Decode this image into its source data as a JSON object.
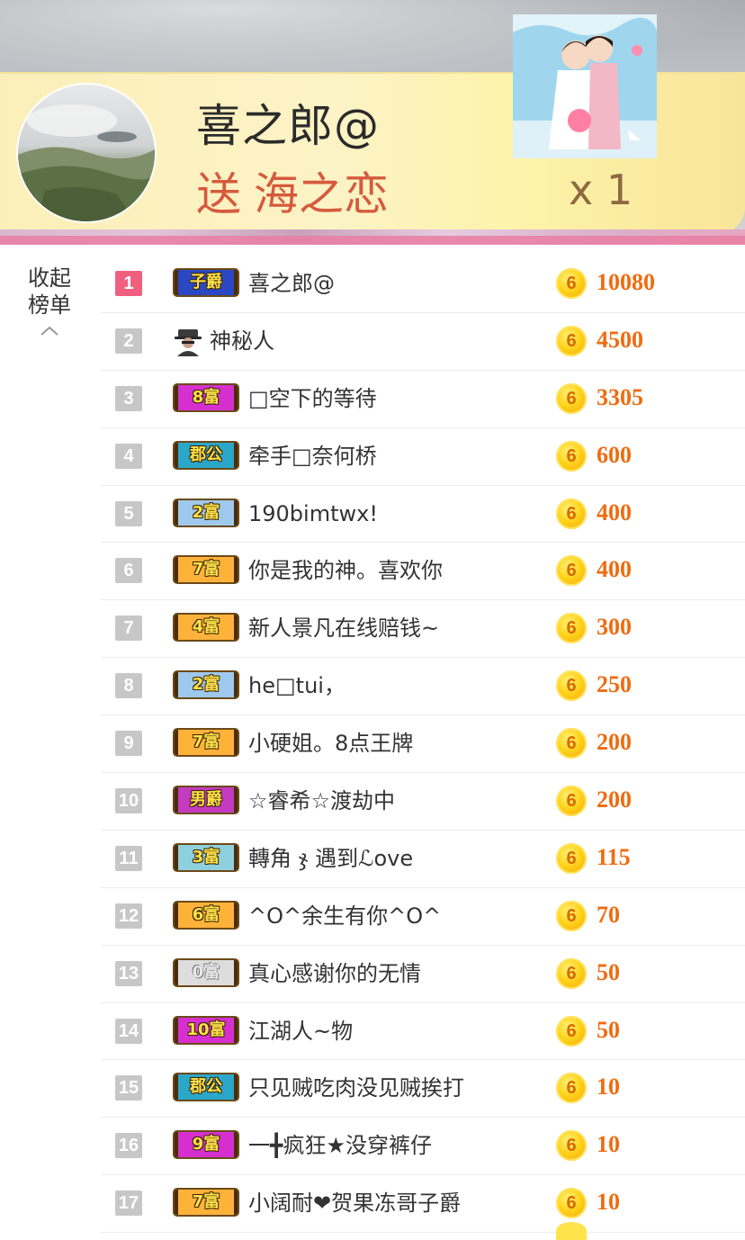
{
  "banner": {
    "sender": "喜之郎@",
    "gift_verb": "送",
    "gift_name": "海之恋",
    "gift_count": "x 1"
  },
  "collapse": {
    "line1": "收起",
    "line2": "榜单",
    "icon": "chevron-up-icon"
  },
  "colors": {
    "rank_first": "#f0607e",
    "rank_default": "#c7c7c7",
    "amount": "#f06b10",
    "coin": "#ffd21a"
  },
  "ranking": [
    {
      "rank": "1",
      "badge": "子爵",
      "badge_color": "#2a48c4",
      "name": "喜之郎@",
      "amount": "10080"
    },
    {
      "rank": "2",
      "badge": "",
      "badge_icon": "mystery-person-icon",
      "name": "神秘人",
      "amount": "4500"
    },
    {
      "rank": "3",
      "badge": "8富",
      "badge_color": "#d62fcf",
      "name": "□空下的等待",
      "amount": "3305"
    },
    {
      "rank": "4",
      "badge": "郡公",
      "badge_color": "#2aa7c9",
      "name": "牵手□奈何桥",
      "amount": "600"
    },
    {
      "rank": "5",
      "badge": "2富",
      "badge_color": "#9ec9ec",
      "name": "190bimtwx!",
      "amount": "400"
    },
    {
      "rank": "6",
      "badge": "7富",
      "badge_color": "#ffb23a",
      "name": "你是我的神。喜欢你",
      "amount": "400"
    },
    {
      "rank": "7",
      "badge": "4富",
      "badge_color": "#ffb23a",
      "name": "新人景凡在线赔钱~",
      "amount": "300"
    },
    {
      "rank": "8",
      "badge": "2富",
      "badge_color": "#9ec9ec",
      "name": "he□tui，",
      "amount": "250"
    },
    {
      "rank": "9",
      "badge": "7富",
      "badge_color": "#ffb23a",
      "name": "小硬姐。8点王牌",
      "amount": "200"
    },
    {
      "rank": "10",
      "badge": "男爵",
      "badge_color": "#c43ac0",
      "name": "☆睿希☆渡劫中",
      "amount": "200"
    },
    {
      "rank": "11",
      "badge": "3富",
      "badge_color": "#8fd0df",
      "name": "轉角 ჯ 遇到ℒove",
      "amount": "115"
    },
    {
      "rank": "12",
      "badge": "6富",
      "badge_color": "#ffb23a",
      "name": "^O^余生有你^O^",
      "amount": "70"
    },
    {
      "rank": "13",
      "badge": "0富",
      "badge_color": "#dddddd",
      "name": "真心感谢你的无情",
      "amount": "50"
    },
    {
      "rank": "14",
      "badge": "10富",
      "badge_color": "#d62fcf",
      "name": "江湖人~物",
      "amount": "50"
    },
    {
      "rank": "15",
      "badge": "郡公",
      "badge_color": "#2aa7c9",
      "name": "只见贼吃肉没见贼挨打",
      "amount": "10"
    },
    {
      "rank": "16",
      "badge": "9富",
      "badge_color": "#d62fcf",
      "name": "一╋疯狂★没穿裤仔",
      "amount": "10"
    },
    {
      "rank": "17",
      "badge": "7富",
      "badge_color": "#ffb23a",
      "name": "小阔耐❤贺果冻哥子爵",
      "amount": "10"
    }
  ]
}
